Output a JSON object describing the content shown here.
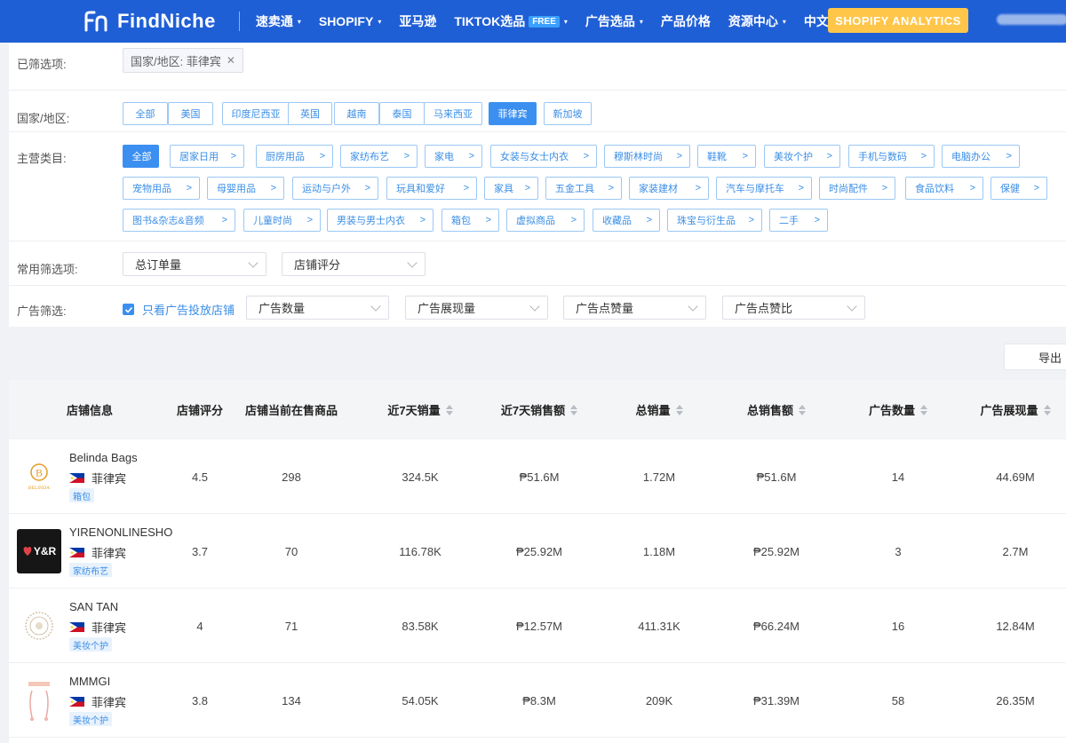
{
  "nav": {
    "logo_text": "FindNiche",
    "items": [
      {
        "label": "速卖通",
        "caret": true
      },
      {
        "label": "SHOPIFY",
        "caret": true
      },
      {
        "label": "亚马逊",
        "caret": false
      },
      {
        "label": "TIKTOK选品",
        "caret": true,
        "badge": "FREE"
      },
      {
        "label": "广告选品",
        "caret": true
      },
      {
        "label": "产品价格",
        "caret": false
      },
      {
        "label": "资源中心",
        "caret": true
      },
      {
        "label": "中文",
        "caret": true
      }
    ],
    "cta_label": "SHOPIFY ANALYTICS"
  },
  "filters": {
    "selected_label": "已筛选项:",
    "selected_tag": "国家/地区: 菲律宾",
    "country_label": "国家/地区:",
    "countries": [
      "全部",
      "美国",
      "印度尼西亚",
      "英国",
      "越南",
      "泰国",
      "马来西亚",
      "菲律宾",
      "新加坡"
    ],
    "active_country": "菲律宾",
    "category_label": "主营类目:",
    "categories": [
      "全部",
      "居家日用",
      "厨房用品",
      "家纺布艺",
      "家电",
      "女装与女士内衣",
      "穆斯林时尚",
      "鞋靴",
      "美妆个护",
      "手机与数码",
      "电脑办公",
      "宠物用品",
      "母婴用品",
      "运动与户外",
      "玩具和爱好",
      "家具",
      "五金工具",
      "家装建材",
      "汽车与摩托车",
      "时尚配件",
      "食品饮料",
      "保健",
      "图书&杂志&音频",
      "儿童时尚",
      "男装与男士内衣",
      "箱包",
      "虚拟商品",
      "收藏品",
      "珠宝与衍生品",
      "二手"
    ],
    "common_label": "常用筛选项:",
    "common_selects": [
      "总订单量",
      "店铺评分"
    ],
    "ad_label": "广告筛选:",
    "ad_checkbox": "只看广告投放店铺",
    "ad_selects": [
      "广告数量",
      "广告展现量",
      "广告点赞量",
      "广告点赞比"
    ]
  },
  "export_label": "导出",
  "table": {
    "headers": [
      "店铺信息",
      "店铺评分",
      "店铺当前在售商品",
      "近7天销量",
      "近7天销售额",
      "总销量",
      "总销售额",
      "广告数量",
      "广告展现量"
    ],
    "rows": [
      {
        "name": "Belinda Bags",
        "country": "菲律宾",
        "category": "箱包",
        "rating": "4.5",
        "products": "298",
        "sales7": "324.5K",
        "revenue7": "₱51.6M",
        "total_sales": "1.72M",
        "total_revenue": "₱51.6M",
        "ads": "14",
        "impressions": "44.69M",
        "logo": "belinda-logo"
      },
      {
        "name": "YIRENONLINESHO",
        "country": "菲律宾",
        "category": "家纺布艺",
        "rating": "3.7",
        "products": "70",
        "sales7": "116.78K",
        "revenue7": "₱25.92M",
        "total_sales": "1.18M",
        "total_revenue": "₱25.92M",
        "ads": "3",
        "impressions": "2.7M",
        "logo": "yr-logo"
      },
      {
        "name": "SAN TAN",
        "country": "菲律宾",
        "category": "美妆个护",
        "rating": "4",
        "products": "71",
        "sales7": "83.58K",
        "revenue7": "₱12.57M",
        "total_sales": "411.31K",
        "total_revenue": "₱66.24M",
        "ads": "16",
        "impressions": "12.84M",
        "logo": "santan-logo"
      },
      {
        "name": "MMMGI",
        "country": "菲律宾",
        "category": "美妆个护",
        "rating": "3.8",
        "products": "134",
        "sales7": "54.05K",
        "revenue7": "₱8.3M",
        "total_sales": "209K",
        "total_revenue": "₱31.39M",
        "ads": "58",
        "impressions": "26.35M",
        "logo": "mmmgi-logo"
      }
    ],
    "logo_texts": {
      "belinda_mark": "B",
      "belinda_text": "BELINDA",
      "yr_text": "Y&R"
    }
  },
  "colors": {
    "nav": "#1f5fd6",
    "accent": "#3b8ff0",
    "cta": "#ffc64a"
  }
}
